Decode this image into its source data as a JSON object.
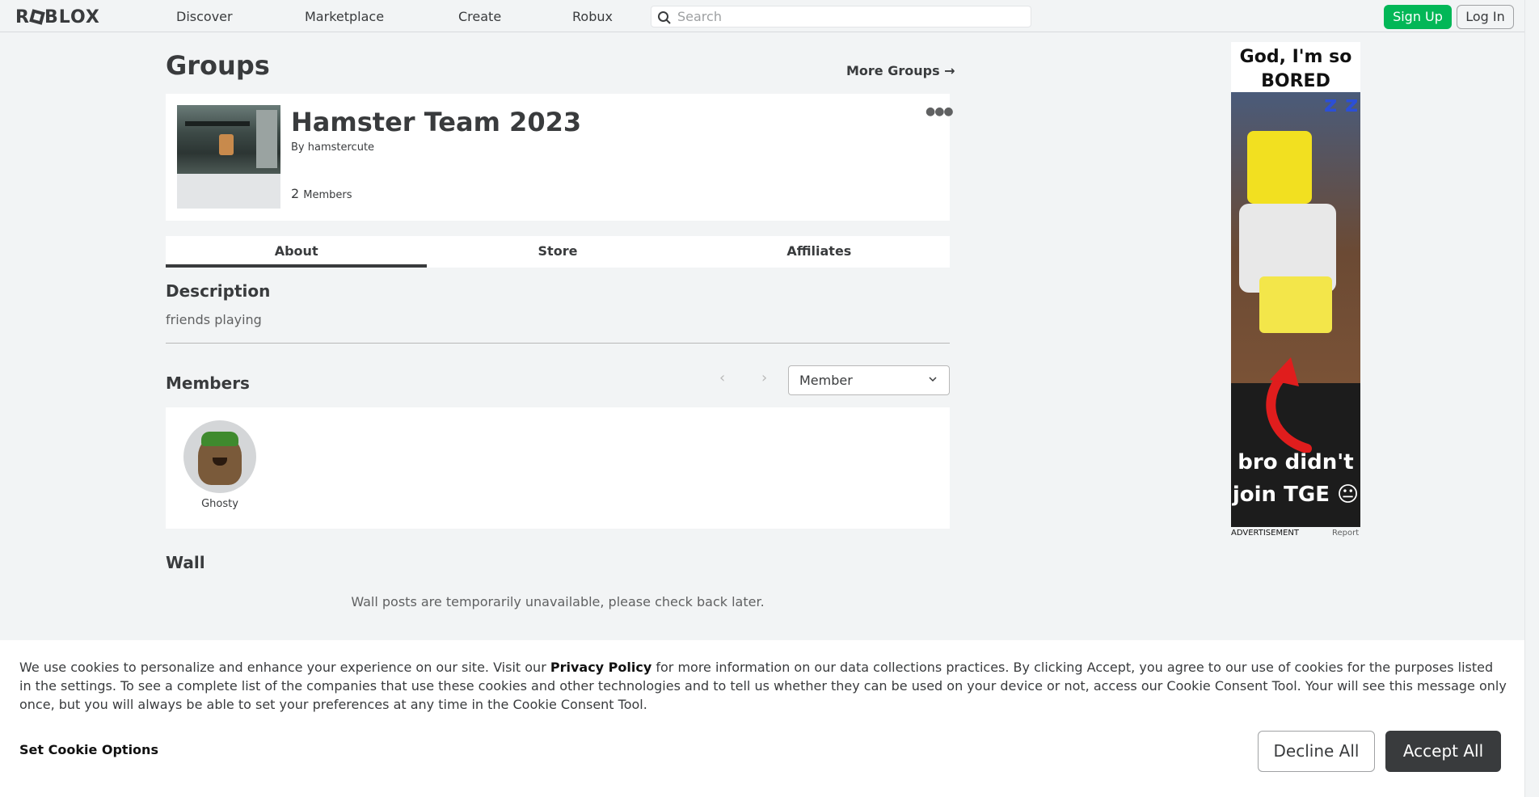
{
  "nav": {
    "logo": "ROBLOX",
    "links": [
      "Discover",
      "Marketplace",
      "Create",
      "Robux"
    ],
    "search_placeholder": "Search",
    "signup_label": "Sign Up",
    "login_label": "Log In"
  },
  "page": {
    "title": "Groups",
    "more_groups": "More Groups →"
  },
  "group": {
    "name": "Hamster Team 2023",
    "by_prefix": "By",
    "owner": "hamstercute",
    "member_count": "2",
    "members_label": "Members",
    "menu_icon": "more-icon"
  },
  "tabs": [
    "About",
    "Store",
    "Affiliates"
  ],
  "description": {
    "heading": "Description",
    "text": "friends playing"
  },
  "members": {
    "heading": "Members",
    "role_selected": "Member",
    "list": [
      {
        "name": "Ghosty"
      }
    ]
  },
  "wall": {
    "heading": "Wall",
    "message": "Wall posts are temporarily unavailable, please check back later."
  },
  "ad": {
    "top_text": "God, I'm so BORED",
    "bottom_text": "bro didn't join TGE 😐",
    "label": "ADVERTISEMENT",
    "report": "Report"
  },
  "cookie": {
    "text_before": "We use cookies to personalize and enhance your experience on our site. Visit our ",
    "policy_link": "Privacy Policy",
    "text_after": " for more information on our data collections practices. By clicking Accept, you agree to our use of cookies for the purposes listed in the settings. To see a complete list of the companies that use these cookies and other technologies and to tell us whether they can be used on your device or not, access our Cookie Consent Tool. Your will see this message only once, but you will always be able to set your preferences at any time in the Cookie Consent Tool.",
    "set_options": "Set Cookie Options",
    "decline": "Decline All",
    "accept": "Accept All"
  }
}
